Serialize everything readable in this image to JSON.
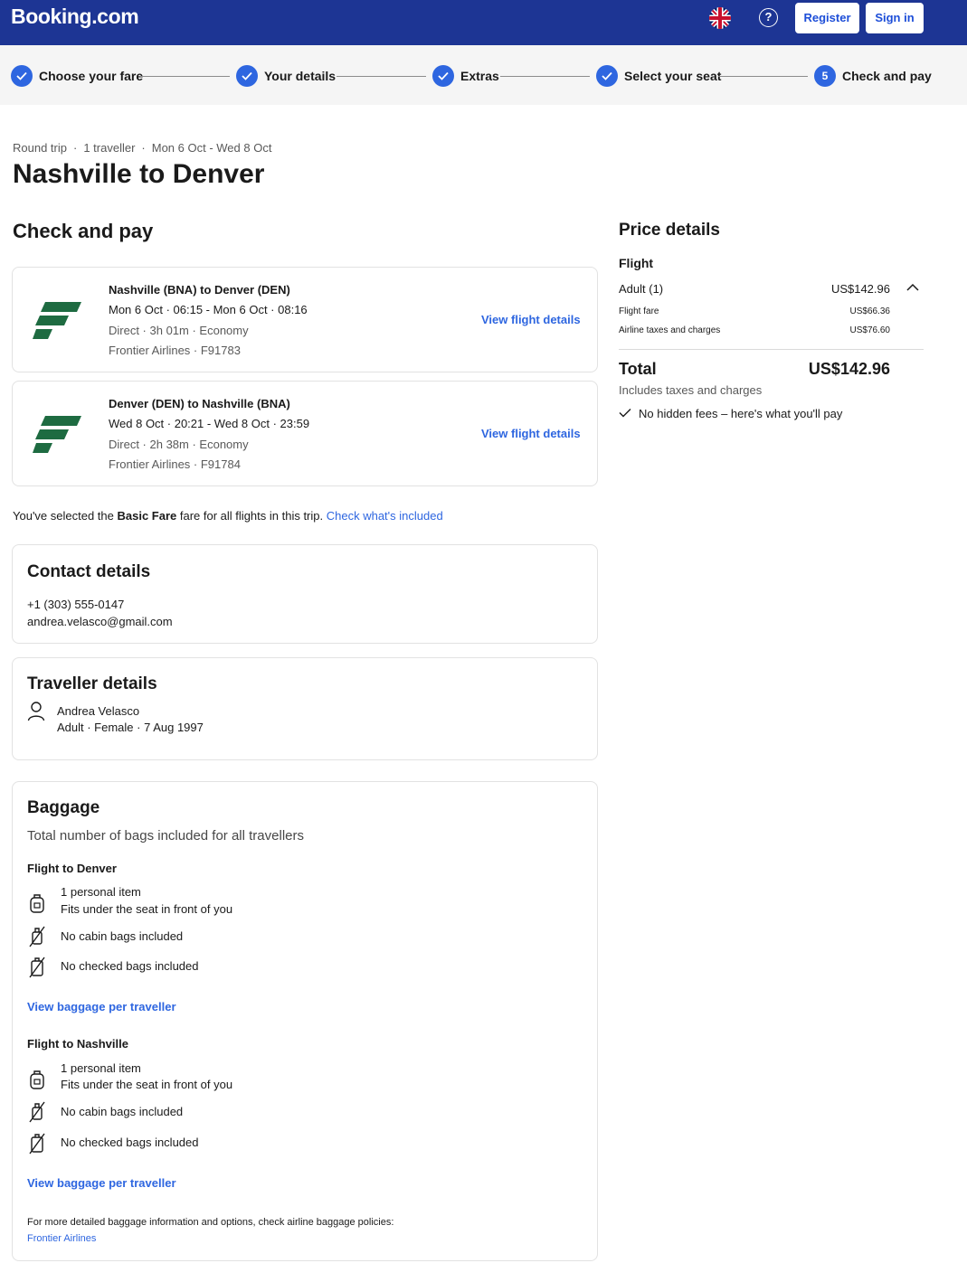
{
  "header": {
    "logo": "Booking.com",
    "language_icon": "uk-flag-icon",
    "help_icon": "question-circle-icon",
    "register_label": "Register",
    "signin_label": "Sign in",
    "brand_color": "#1d3594"
  },
  "progress": {
    "steps": [
      {
        "label": "Choose your fare",
        "state": "done"
      },
      {
        "label": "Your details",
        "state": "done"
      },
      {
        "label": "Extras",
        "state": "done"
      },
      {
        "label": "Select your seat",
        "state": "done"
      },
      {
        "label": "Check and pay",
        "state": "current",
        "number": "5"
      }
    ]
  },
  "trip": {
    "type": "Round trip",
    "travellers": "1 traveller",
    "dates": "Mon 6 Oct - Wed 8 Oct",
    "title": "Nashville to Denver"
  },
  "check_and_pay": {
    "title": "Check and pay",
    "flights": [
      {
        "route": "Nashville (BNA) to Denver (DEN)",
        "times": "Mon 6 Oct · 06:15 - Mon 6 Oct · 08:16",
        "meta": "Direct · 3h 01m · Economy",
        "airline": "Frontier Airlines · F91783",
        "link": "View flight details"
      },
      {
        "route": "Denver (DEN) to Nashville (BNA)",
        "times": "Wed 8 Oct · 20:21 - Wed 8 Oct · 23:59",
        "meta": "Direct · 2h 38m · Economy",
        "airline": "Frontier Airlines · F91784",
        "link": "View flight details"
      }
    ],
    "fare_note_prefix": "You've selected the",
    "fare_name": "Basic Fare",
    "fare_note_suffix": "fare for all flights in this trip.",
    "fare_link": "Check what's included"
  },
  "contact": {
    "title": "Contact details",
    "phone": "+1 (303) 555-0147",
    "email": "andrea.velasco@gmail.com"
  },
  "traveller": {
    "title": "Traveller details",
    "name": "Andrea Velasco",
    "details": "Adult · Female · 7 Aug 1997"
  },
  "baggage": {
    "title": "Baggage",
    "subtitle": "Total number of bags included for all travellers",
    "flights": [
      {
        "heading": "Flight to Denver",
        "personal": "1 personal item",
        "personal_sub": "Fits under the seat in front of you",
        "cabin": "No cabin bags included",
        "checked": "No checked bags included",
        "link": "View baggage per traveller"
      },
      {
        "heading": "Flight to Nashville",
        "personal": "1 personal item",
        "personal_sub": "Fits under the seat in front of you",
        "cabin": "No cabin bags included",
        "checked": "No checked bags included",
        "link": "View baggage per traveller"
      }
    ],
    "policy_note": "For more detailed baggage information and options, check airline baggage policies:",
    "policy_link": "Frontier Airlines"
  },
  "price": {
    "title": "Price details",
    "section": "Flight",
    "adult_label": "Adult (1)",
    "adult_value": "US$142.96",
    "fare_label": "Flight fare",
    "fare_value": "US$66.36",
    "taxes_label": "Airline taxes and charges",
    "taxes_value": "US$76.60",
    "total_label": "Total",
    "total_value": "US$142.96",
    "total_note": "Includes taxes and charges",
    "guarantee": "No hidden fees – here's what you'll pay"
  }
}
